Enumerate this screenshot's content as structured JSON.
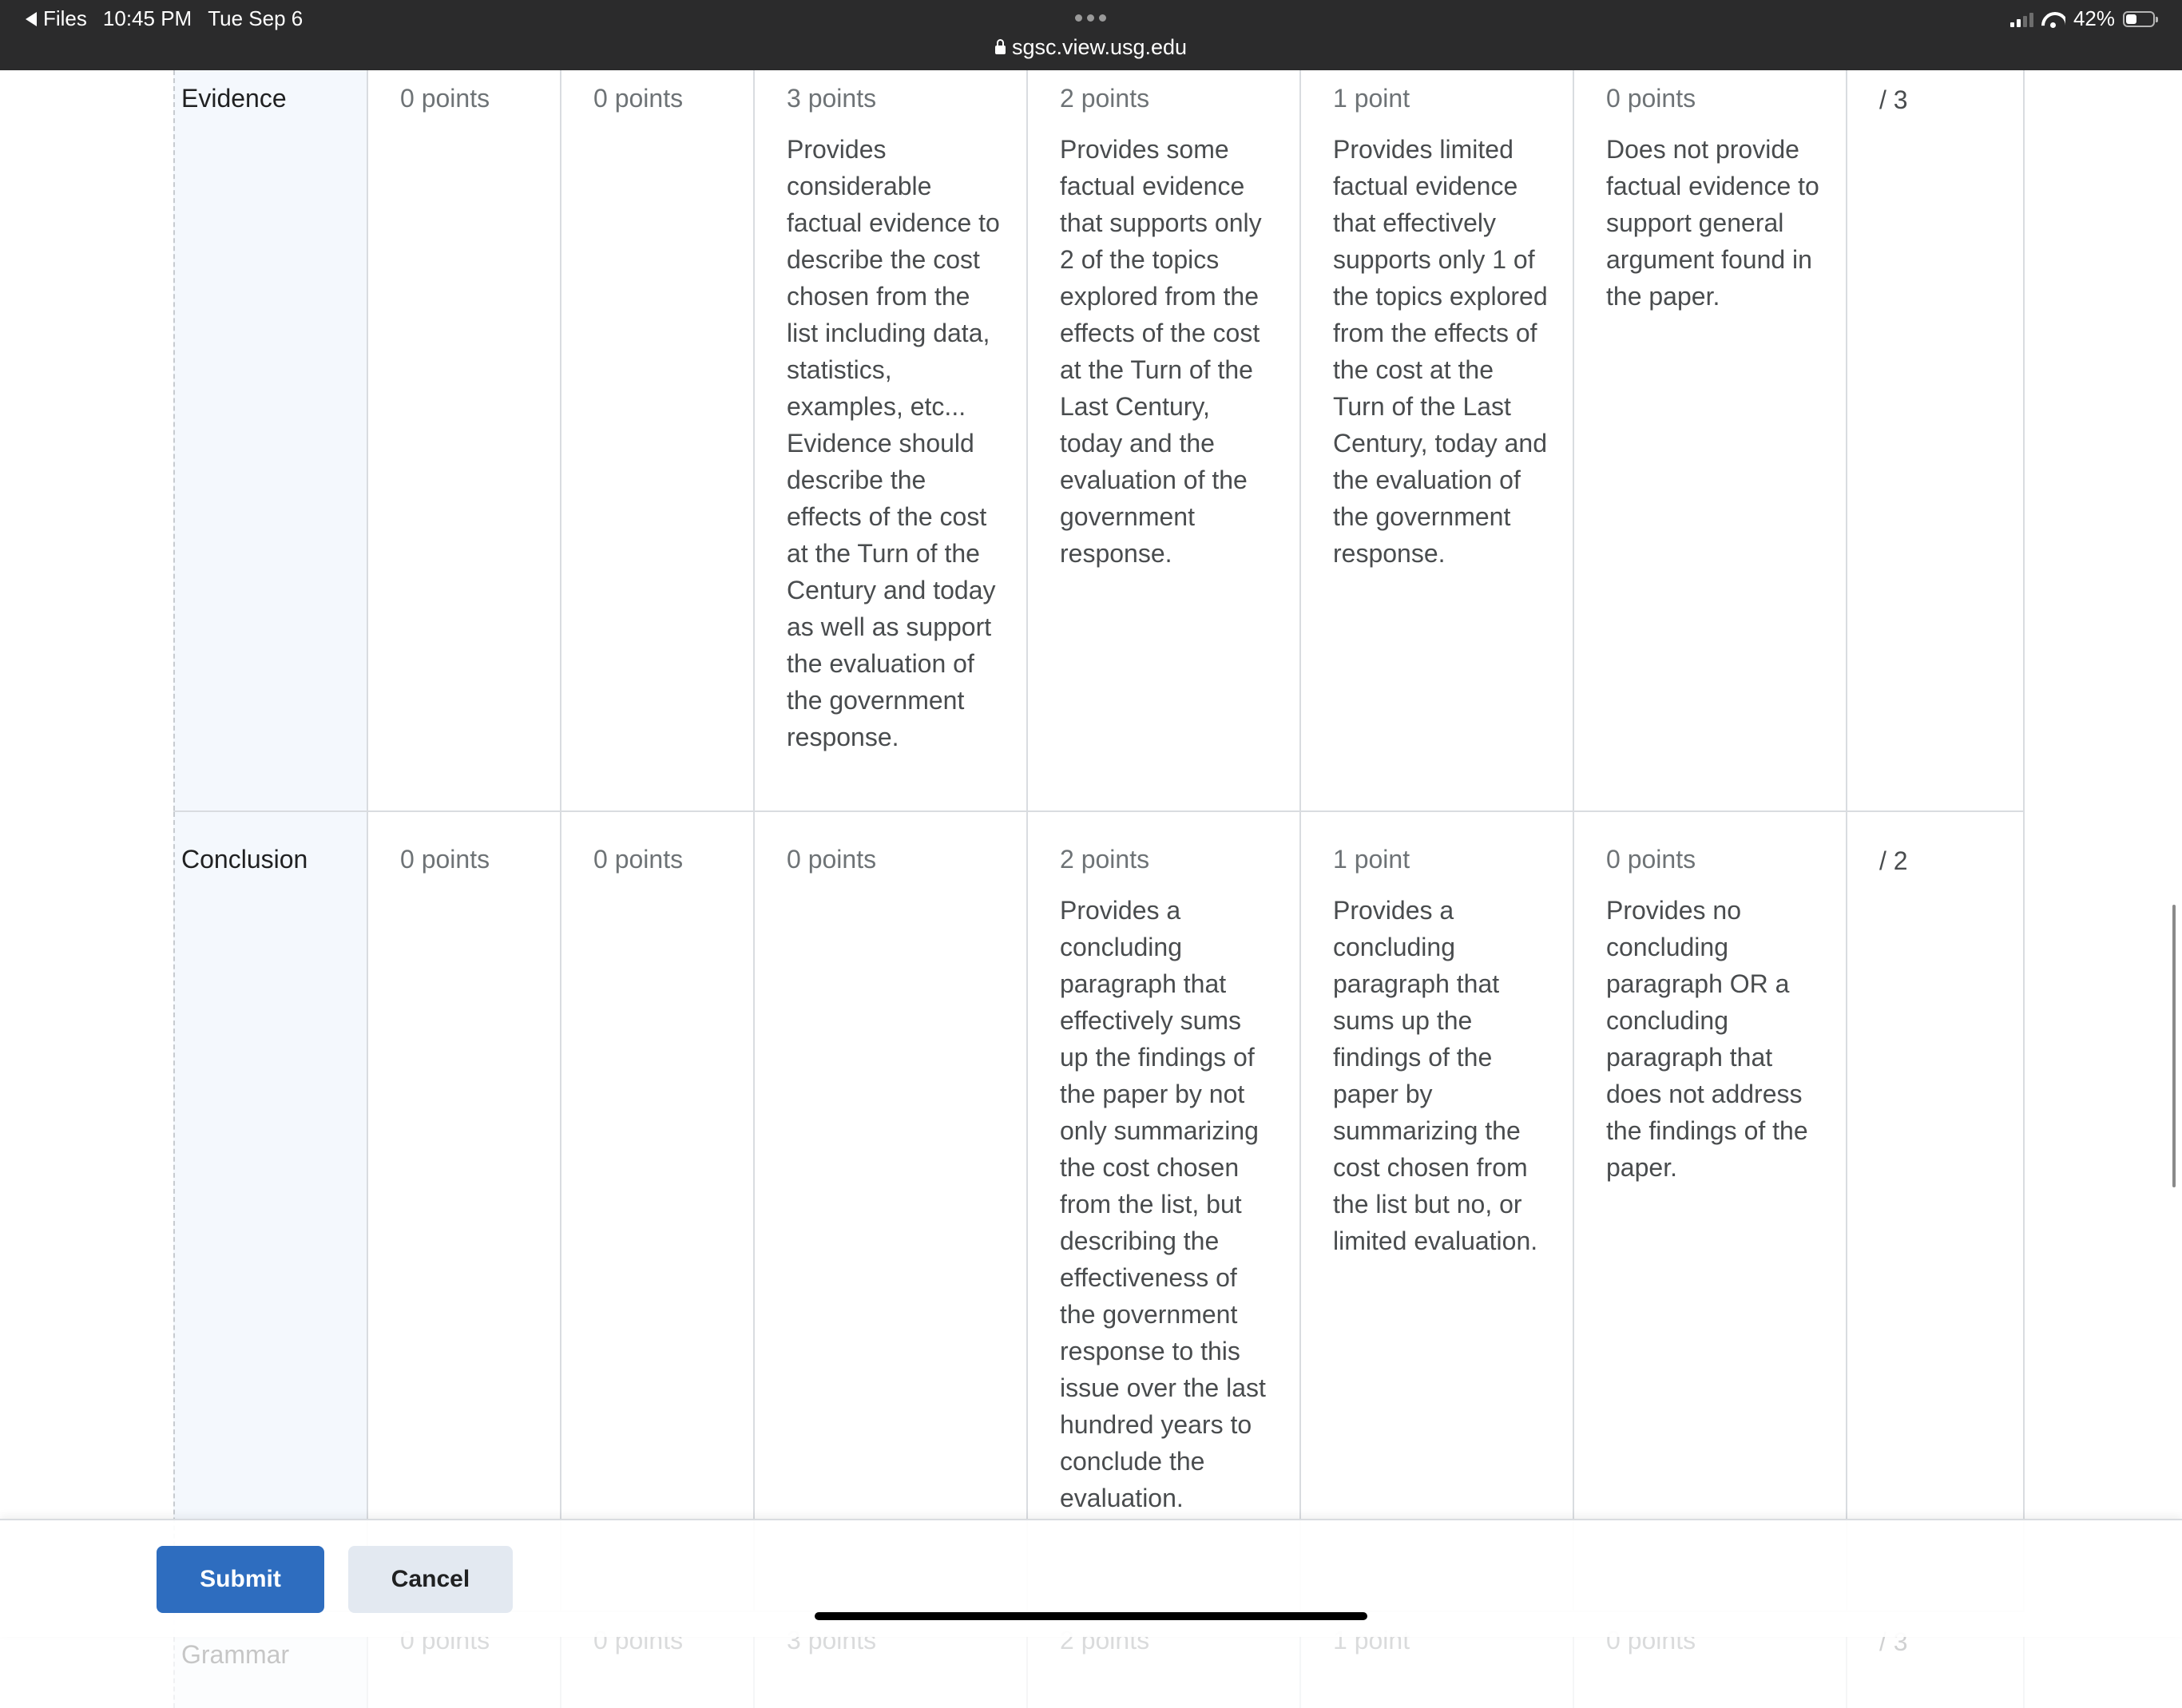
{
  "status_bar": {
    "back_label": "Files",
    "time": "10:45 PM",
    "date": "Tue Sep 6",
    "url": "sgsc.view.usg.edu",
    "battery": "42%",
    "battery_level": 0.42
  },
  "rubric": {
    "rows": [
      {
        "criterion": "Evidence",
        "levels": [
          {
            "points": "0 points",
            "description": ""
          },
          {
            "points": "0 points",
            "description": ""
          },
          {
            "points": "3 points",
            "description": "Provides considerable factual evidence to describe the cost chosen from the list including data, statistics, examples, etc... Evidence should describe the effects of the cost at the Turn of the Century and today as well as support the evaluation of the government response."
          },
          {
            "points": "2 points",
            "description": "Provides some factual evidence that supports only 2 of the topics explored from the effects of the cost at the Turn of the Last Century, today and the evaluation of the government response."
          },
          {
            "points": "1 point",
            "description": "Provides limited factual evidence that effectively supports only 1 of the topics explored from the effects of the cost at the Turn of the Last Century, today and the evaluation of the government response."
          },
          {
            "points": "0 points",
            "description": "Does not provide factual evidence to support general argument found in the paper."
          }
        ],
        "score": "/ 3"
      },
      {
        "criterion": "Conclusion",
        "levels": [
          {
            "points": "0 points",
            "description": ""
          },
          {
            "points": "0 points",
            "description": ""
          },
          {
            "points": "0 points",
            "description": ""
          },
          {
            "points": "2 points",
            "description": "Provides a concluding paragraph that effectively sums up the findings of the paper by not only  summarizing the cost chosen from the list, but describing the effectiveness of the government response to this issue over the last hundred years to conclude the evaluation."
          },
          {
            "points": "1 point",
            "description": "Provides a concluding paragraph that sums up the findings of the paper by summarizing the cost chosen from the list but no, or limited evaluation."
          },
          {
            "points": "0 points",
            "description": "Provides no concluding paragraph OR a concluding paragraph that does not address the findings of the paper."
          }
        ],
        "score": "/ 2"
      },
      {
        "criterion": "Grammar",
        "levels": [
          {
            "points": "0 points"
          },
          {
            "points": "0 points"
          },
          {
            "points": "3 points"
          },
          {
            "points": "2 points"
          },
          {
            "points": "1 point"
          },
          {
            "points": "0 points"
          }
        ],
        "score": "/ 3"
      }
    ]
  },
  "actions": {
    "submit_label": "Submit",
    "cancel_label": "Cancel"
  }
}
